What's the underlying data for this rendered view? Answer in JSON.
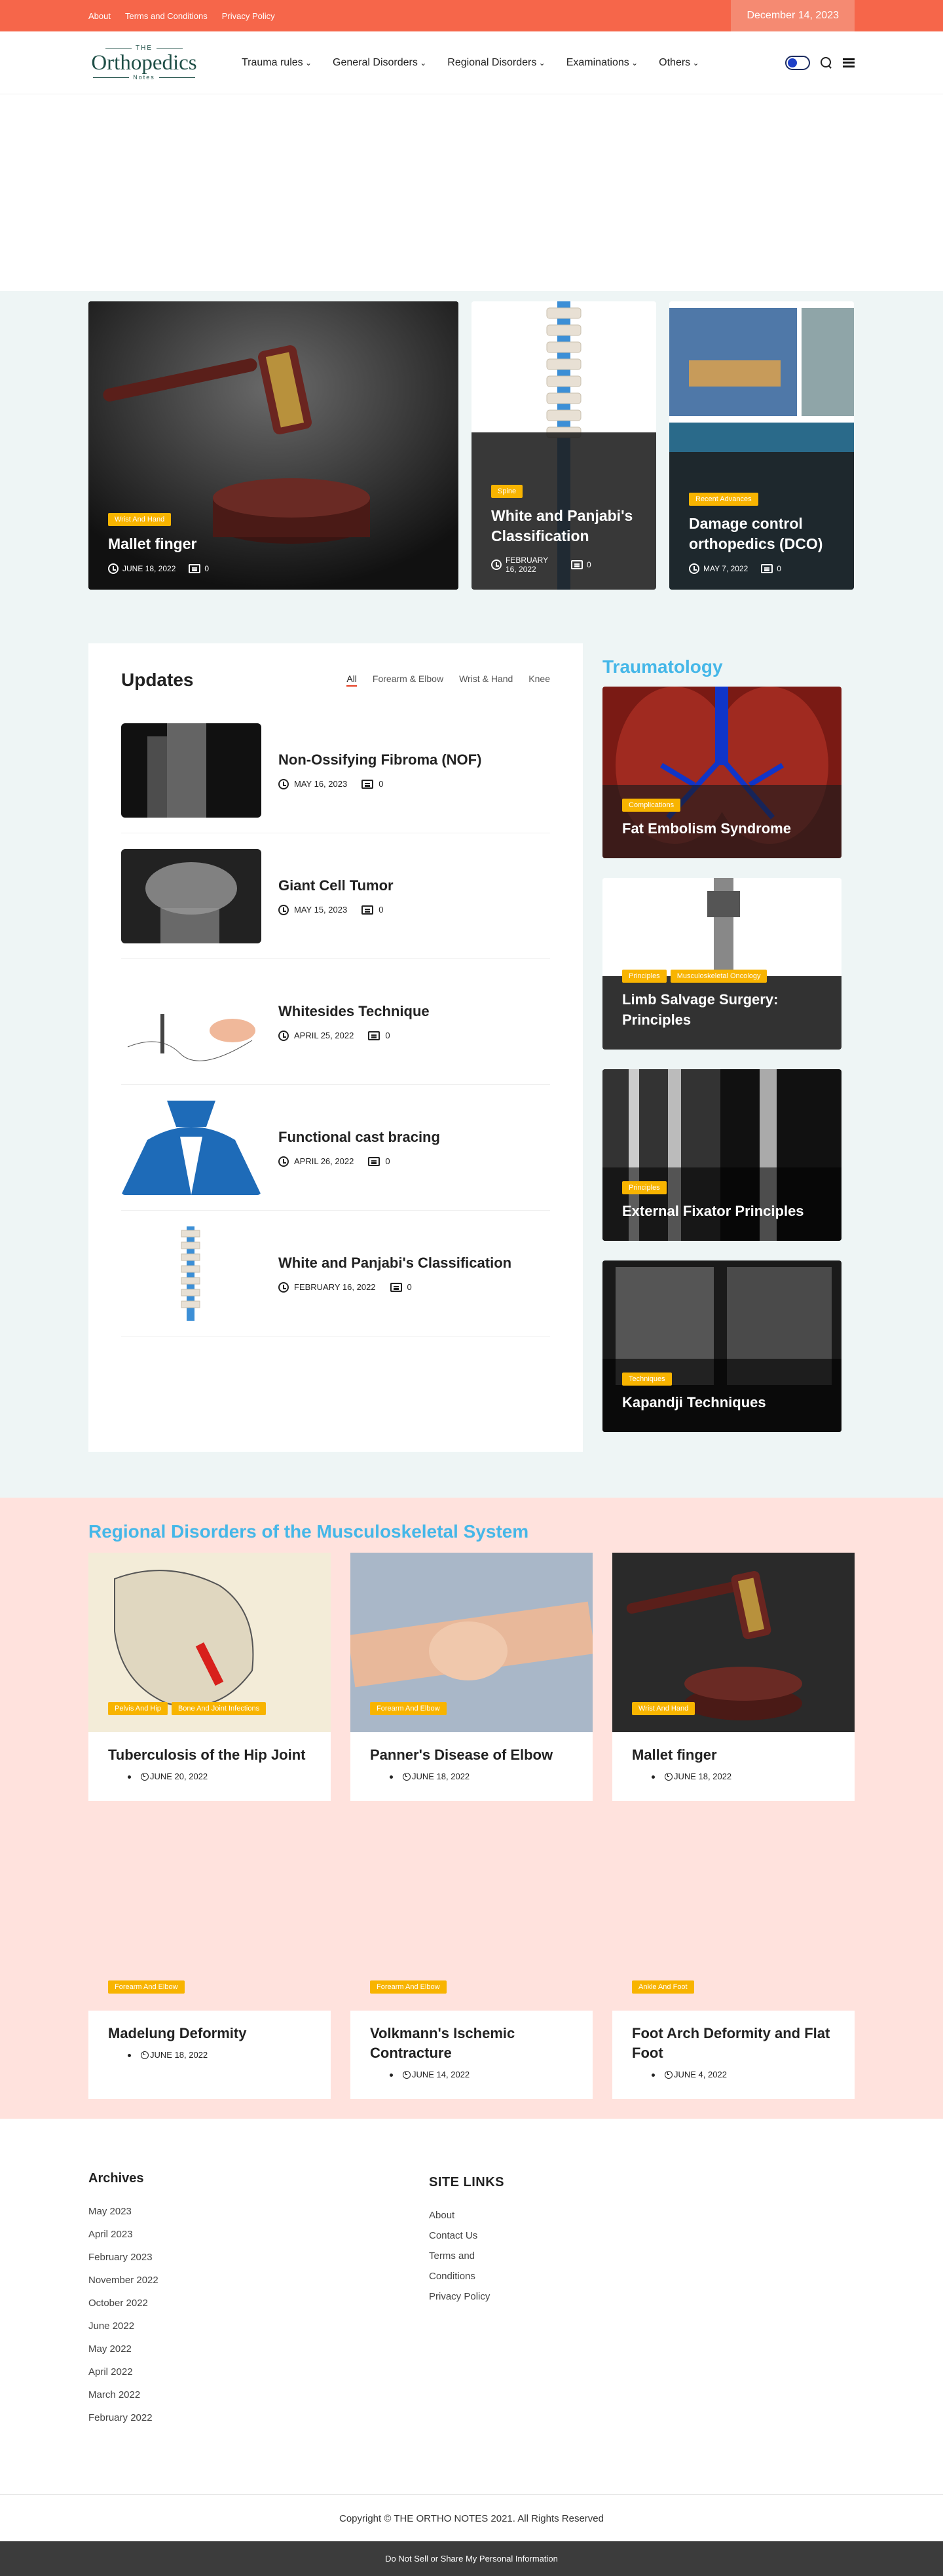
{
  "topbar": {
    "links": [
      "About",
      "Terms and Conditions",
      "Privacy Policy"
    ],
    "date": "December 14, 2023"
  },
  "logo": {
    "the": "THE",
    "name": "Orthopedics",
    "notes": "Notes"
  },
  "nav": [
    "Trauma rules",
    "General Disorders",
    "Regional Disorders",
    "Examinations",
    "Others"
  ],
  "hero": [
    {
      "tag": "Wrist And Hand",
      "title": "Mallet finger",
      "date": "JUNE 18, 2022",
      "comments": "0"
    },
    {
      "tag": "Spine",
      "title": "White and Panjabi's Classification",
      "date": "FEBRUARY 16, 2022",
      "comments": "0"
    },
    {
      "tag": "Recent Advances",
      "title": "Damage control orthopedics (DCO)",
      "date": "MAY 7, 2022",
      "comments": "0"
    }
  ],
  "updates": {
    "title": "Updates",
    "filters": [
      "All",
      "Forearm & Elbow",
      "Wrist & Hand",
      "Knee"
    ],
    "items": [
      {
        "title": "Non-Ossifying Fibroma (NOF)",
        "date": "MAY 16, 2023",
        "comments": "0"
      },
      {
        "title": "Giant Cell Tumor",
        "date": "MAY 15, 2023",
        "comments": "0"
      },
      {
        "title": "Whitesides Technique",
        "date": "APRIL 25, 2022",
        "comments": "0"
      },
      {
        "title": "Functional cast bracing",
        "date": "APRIL 26, 2022",
        "comments": "0"
      },
      {
        "title": "White and Panjabi's Classification",
        "date": "FEBRUARY 16, 2022",
        "comments": "0"
      }
    ]
  },
  "traumatology": {
    "title": "Traumatology",
    "cards": [
      {
        "tags": [
          "Complications"
        ],
        "title": "Fat Embolism Syndrome"
      },
      {
        "tags": [
          "Principles",
          "Musculoskeletal Oncology"
        ],
        "title": "Limb Salvage Surgery: Principles"
      },
      {
        "tags": [
          "Principles"
        ],
        "title": "External Fixator Principles"
      },
      {
        "tags": [
          "Techniques"
        ],
        "title": "Kapandji Techniques"
      }
    ]
  },
  "regional": {
    "title": "Regional Disorders of the Musculoskeletal System",
    "cards": [
      {
        "tags": [
          "Pelvis And Hip",
          "Bone And Joint Infections"
        ],
        "title": "Tuberculosis of the Hip Joint",
        "date": "JUNE 20, 2022"
      },
      {
        "tags": [
          "Forearm And Elbow"
        ],
        "title": "Panner's Disease of Elbow",
        "date": "JUNE 18, 2022"
      },
      {
        "tags": [
          "Wrist And Hand"
        ],
        "title": "Mallet finger",
        "date": "JUNE 18, 2022"
      },
      {
        "tags": [
          "Forearm And Elbow"
        ],
        "title": "Madelung Deformity",
        "date": "JUNE 18, 2022"
      },
      {
        "tags": [
          "Forearm And Elbow"
        ],
        "title": "Volkmann's Ischemic Contracture",
        "date": "JUNE 14, 2022"
      },
      {
        "tags": [
          "Ankle And Foot"
        ],
        "title": "Foot Arch Deformity and Flat Foot",
        "date": "JUNE 4, 2022"
      }
    ]
  },
  "footer": {
    "archives_title": "Archives",
    "archives": [
      "May 2023",
      "April 2023",
      "February 2023",
      "November 2022",
      "October 2022",
      "June 2022",
      "May 2022",
      "April 2022",
      "March 2022",
      "February 2022"
    ],
    "site_title": "SITE LINKS",
    "site_links": [
      "About",
      "Contact Us",
      "Terms and",
      "Conditions",
      "Privacy Policy"
    ],
    "copyright": "Copyright © THE ORTHO NOTES 2021. All Rights Reserved",
    "ccpa": "Do Not Sell or Share My Personal Information"
  },
  "colors": {
    "topbar": "#f6664a",
    "tag": "#f8b400",
    "accent_blue": "#45b7e8",
    "regional_bg": "#ffe2dd",
    "light_bg": "#eef5f5"
  }
}
